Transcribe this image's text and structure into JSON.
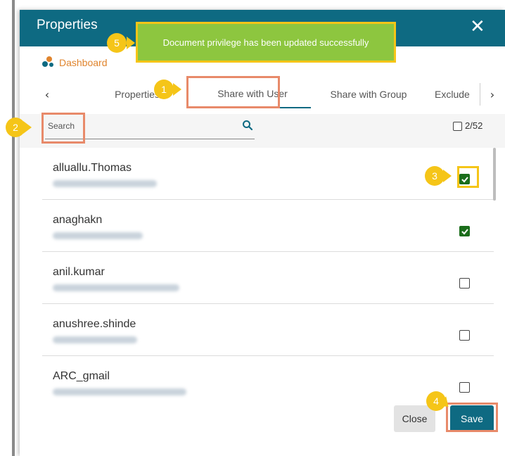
{
  "dialog": {
    "title": "Properties",
    "close_icon": "close-icon"
  },
  "breadcrumb": {
    "label": "Dashboard",
    "icon": "dashboard-icon"
  },
  "tabs": [
    {
      "label": "Properties"
    },
    {
      "label": "Share with User",
      "active": true
    },
    {
      "label": "Share with Group"
    },
    {
      "label": "Exclude"
    }
  ],
  "search": {
    "placeholder": "Search",
    "icon": "search-icon"
  },
  "selection_count": "2/52",
  "users": [
    {
      "name": "alluallu.Thomas",
      "checked": true
    },
    {
      "name": "anaghakn",
      "checked": true
    },
    {
      "name": "anil.kumar",
      "checked": false
    },
    {
      "name": "anushree.shinde",
      "checked": false
    },
    {
      "name": "ARC_gmail",
      "checked": false
    }
  ],
  "buttons": {
    "close": "Close",
    "save": "Save"
  },
  "toast": {
    "message": "Document privilege has been updated successfully"
  },
  "annotations": [
    "1",
    "2",
    "3",
    "4",
    "5"
  ],
  "colors": {
    "header": "#0e6a82",
    "accent": "#e0842d",
    "toast": "#8dc63f",
    "badge": "#f5c518",
    "highlight": "#e88a6a",
    "checked": "#1b6d1b"
  }
}
